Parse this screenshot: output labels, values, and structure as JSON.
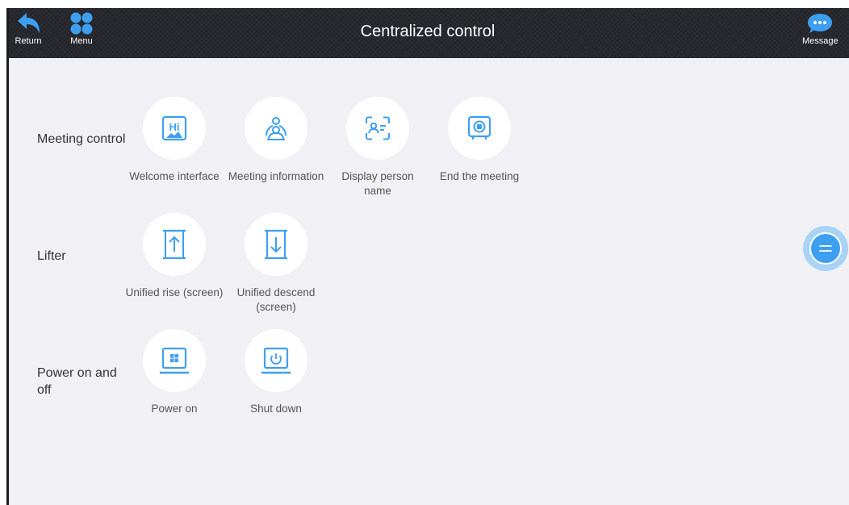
{
  "header": {
    "title": "Centralized control",
    "return_label": "Return",
    "menu_label": "Menu",
    "message_label": "Message"
  },
  "sections": {
    "meeting_control": {
      "label": "Meeting control",
      "items": [
        {
          "label": "Welcome interface",
          "icon": "welcome-hi-icon"
        },
        {
          "label": "Meeting information",
          "icon": "meeting-people-icon"
        },
        {
          "label": "Display person name",
          "icon": "person-scan-icon"
        },
        {
          "label": "End the meeting",
          "icon": "end-meeting-icon"
        }
      ]
    },
    "lifter": {
      "label": "Lifter",
      "items": [
        {
          "label": "Unified rise (screen)",
          "icon": "rise-arrow-icon"
        },
        {
          "label": "Unified descend (screen)",
          "icon": "descend-arrow-icon"
        }
      ]
    },
    "power": {
      "label": "Power on and off",
      "items": [
        {
          "label": "Power on",
          "icon": "windows-monitor-icon"
        },
        {
          "label": "Shut down",
          "icon": "power-monitor-icon"
        }
      ]
    }
  },
  "colors": {
    "accent": "#3e9ef0",
    "header_bg": "#23252b",
    "page_bg": "#f1f1f5"
  }
}
